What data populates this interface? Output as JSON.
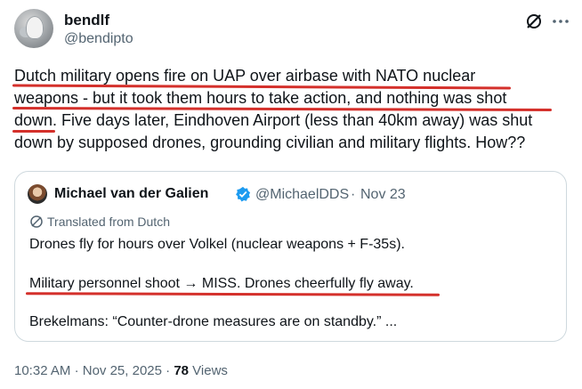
{
  "author": {
    "display_name": "bendlf",
    "handle": "@bendipto"
  },
  "tweet": {
    "line1": "Dutch military opens fire on UAP over airbase with NATO nuclear",
    "line2": "weapons - but it took them hours to take action, and nothing was shot",
    "line3": "down. Five days later, Eindhoven Airport (less than 40km away) was shut",
    "line4": "down by supposed drones, grounding civilian and military flights. How??"
  },
  "quote": {
    "author_name": "Michael van der Galien",
    "handle": "@MichaelDDS",
    "separator": "·",
    "date": "Nov 23",
    "translated_label": "Translated from Dutch",
    "line1": "Drones fly for hours over Volkel (nuclear weapons + F-35s).",
    "line2": "Military personnel shoot → MISS. Drones cheerfully fly away.",
    "line3": "Brekelmans: “Counter-drone measures are on standby.” ..."
  },
  "footer": {
    "time": "10:32 AM",
    "sep1": "·",
    "date": "Nov 25, 2025",
    "sep2": "·",
    "views_count": "78",
    "views_label": "Views"
  },
  "colors": {
    "annotation_red": "#d4302b",
    "verified_blue": "#1d9bf0",
    "secondary_text": "#536471"
  },
  "icons": [
    "grok-icon",
    "more-icon",
    "verified-badge-icon",
    "translate-icon"
  ]
}
